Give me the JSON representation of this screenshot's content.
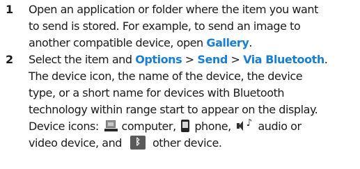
{
  "steps": [
    {
      "number": "1",
      "line1": "Open an application or folder where the item you want",
      "line2": "to send is stored. For example, to send an image to",
      "line3_pre": "another compatible device, open ",
      "line3_link": "Gallery",
      "line3_post": "."
    },
    {
      "number": "2",
      "line1_pre": "Select the item and ",
      "options": "Options",
      "sep1": " > ",
      "send": "Send",
      "sep2": " > ",
      "via": "Via Bluetooth",
      "line1_post": ".",
      "line2": "The device icon, the name of the device, the device",
      "line3": "type, or a short name for devices with Bluetooth",
      "line4": "technology within range start to appear on the display.",
      "line5_prefix": "Device icons: ",
      "computer_label": "computer,",
      "phone_label": "phone,",
      "audio_label": "audio or",
      "line6_pre": "video device, and",
      "other_label": "other device."
    }
  ],
  "icons": {
    "computer": "computer-icon",
    "phone": "phone-icon",
    "audio": "audio-device-icon",
    "other": "bluetooth-device-icon"
  },
  "colors": {
    "text": "#1a1a1a",
    "highlight": "#1a7fd2"
  }
}
